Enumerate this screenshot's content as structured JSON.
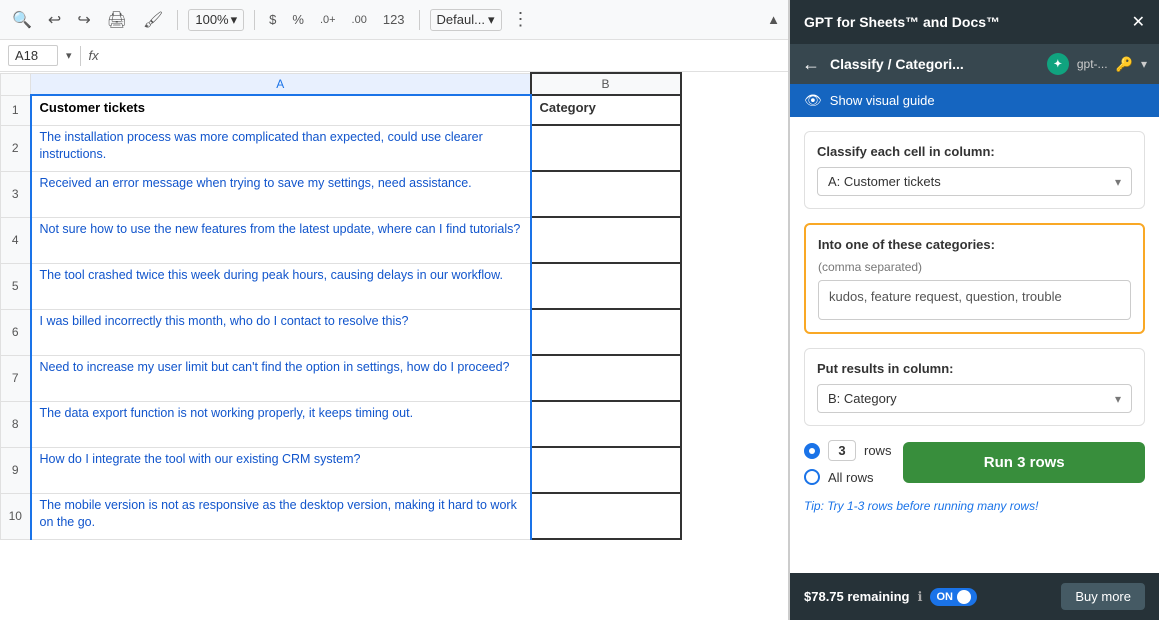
{
  "toolbar": {
    "zoom": "100%",
    "currency": "$",
    "percent": "%",
    "decimal_increase": ".0+",
    "decimal_more": ".00",
    "number": "123",
    "format_label": "Defaul...",
    "more_icon": "⋮",
    "chevron_up": "▲"
  },
  "formula_bar": {
    "cell_ref": "A18",
    "fx_label": "fx"
  },
  "spreadsheet": {
    "col_a_header": "A",
    "col_b_header": "B",
    "rows": [
      {
        "row_num": "1",
        "col_a": "Customer tickets",
        "col_b": "Category",
        "is_header": true
      },
      {
        "row_num": "2",
        "col_a": "The installation process was more complicated than expected, could use clearer instructions.",
        "col_b": ""
      },
      {
        "row_num": "3",
        "col_a": "Received an error message when trying to save my settings, need assistance.",
        "col_b": ""
      },
      {
        "row_num": "4",
        "col_a": "Not sure how to use the new features from the latest update, where can I find tutorials?",
        "col_b": ""
      },
      {
        "row_num": "5",
        "col_a": "The tool crashed twice this week during peak hours, causing delays in our workflow.",
        "col_b": ""
      },
      {
        "row_num": "6",
        "col_a": "I was billed incorrectly this month, who do I contact to resolve this?",
        "col_b": ""
      },
      {
        "row_num": "7",
        "col_a": "Need to increase my user limit but can't find the option in settings, how do I proceed?",
        "col_b": ""
      },
      {
        "row_num": "8",
        "col_a": "The data export function is not working properly, it keeps timing out.",
        "col_b": ""
      },
      {
        "row_num": "9",
        "col_a": "How do I integrate the tool with our existing CRM system?",
        "col_b": ""
      },
      {
        "row_num": "10",
        "col_a": "The mobile version is not as responsive as the desktop version, making it hard to work on the go.",
        "col_b": ""
      }
    ]
  },
  "panel": {
    "header_title": "GPT for Sheets™ and Docs™",
    "nav_title": "Classify / Categori...",
    "model_label": "gpt-...",
    "visual_guide_label": "Show visual guide",
    "classify_label": "Classify each cell in column:",
    "classify_column": "A: Customer tickets",
    "categories_label": "Into one of these categories:",
    "categories_sublabel": "(comma separated)",
    "categories_value": "kudos, feature request, question, trouble",
    "results_label": "Put results in column:",
    "results_column": "B: Category",
    "rows_count": "3",
    "run_btn_label": "Run 3 rows",
    "all_rows_label": "All rows",
    "tip_text": "Tip: Try 1-3 rows before running many rows!",
    "balance": "$78.75 remaining",
    "toggle_label": "ON",
    "buy_more_label": "Buy more"
  }
}
